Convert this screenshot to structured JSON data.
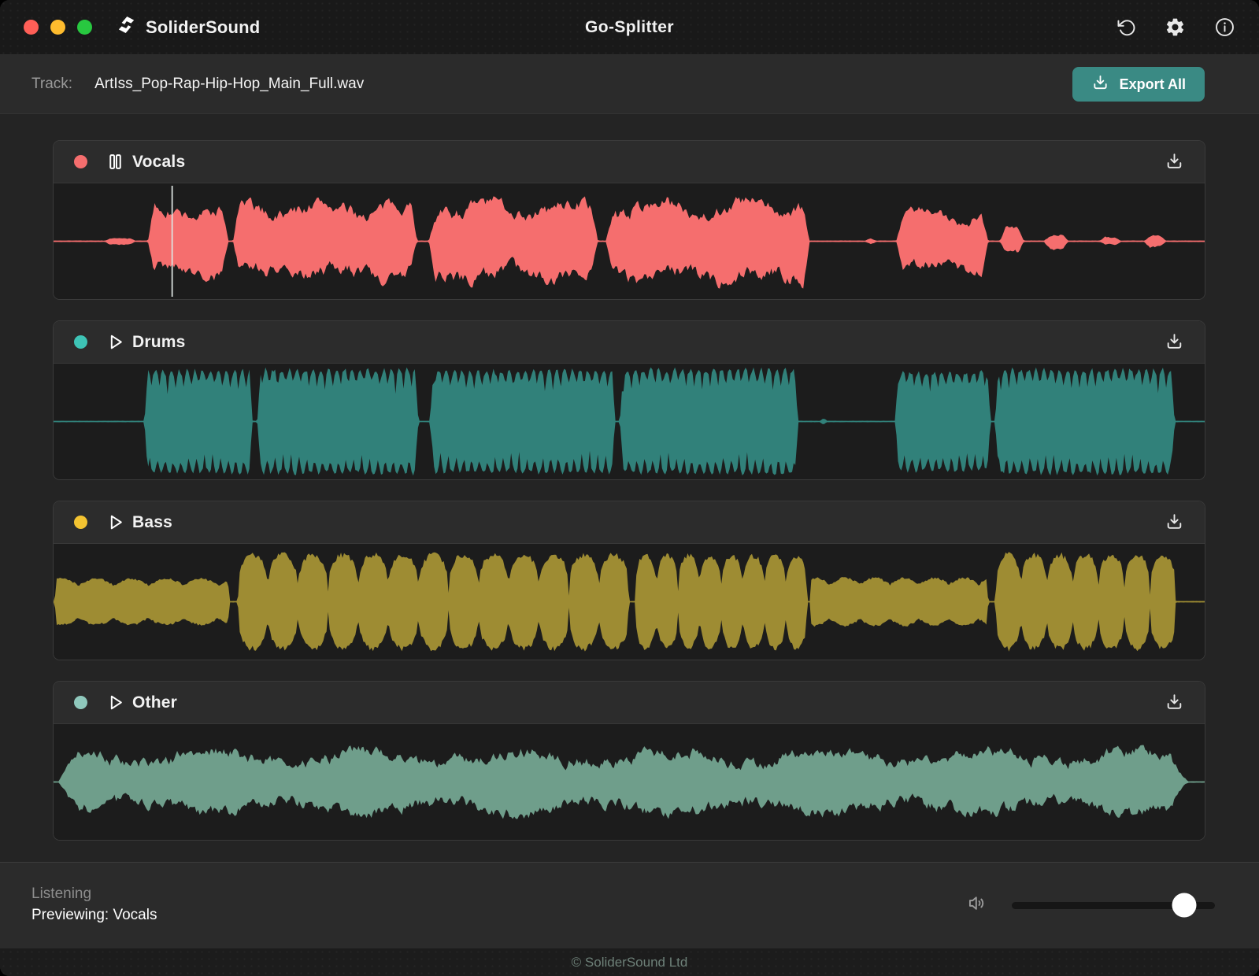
{
  "titlebar": {
    "brand": "SoliderSound",
    "title": "Go-Splitter",
    "window_controls": [
      "close",
      "minimize",
      "zoom"
    ],
    "window_control_colors": {
      "close": "#ff5f57",
      "minimize": "#febc2e",
      "zoom": "#28c840"
    },
    "icons": [
      "brand-logo-icon",
      "reset-icon",
      "settings-icon",
      "info-icon"
    ]
  },
  "trackbar": {
    "label": "Track:",
    "filename": "ArtIss_Pop-Rap-Hip-Hop_Main_Full.wav",
    "export_label": "Export All",
    "export_icon": "download-icon"
  },
  "colors": {
    "accent": "#3a8a84",
    "page_background": "#242424",
    "panel_background": "#2b2b2b",
    "waveform_background": "#1c1c1c"
  },
  "stems": [
    {
      "name": "Vocals",
      "state": "playing",
      "transport_icon": "pause-icon",
      "color": "#f56e6e",
      "dot_color": "#f56e6e",
      "style": "smooth",
      "seed": 7,
      "playhead": 0.103,
      "segments": [
        {
          "s": 0.043,
          "e": 0.072,
          "a": 0.07
        },
        {
          "s": 0.082,
          "e": 0.152,
          "a": 0.74
        },
        {
          "s": 0.156,
          "e": 0.316,
          "a": 0.8
        },
        {
          "s": 0.326,
          "e": 0.473,
          "a": 0.82
        },
        {
          "s": 0.48,
          "e": 0.657,
          "a": 0.84
        },
        {
          "s": 0.704,
          "e": 0.716,
          "a": 0.08
        },
        {
          "s": 0.732,
          "e": 0.812,
          "a": 0.64
        },
        {
          "s": 0.822,
          "e": 0.843,
          "a": 0.32
        },
        {
          "s": 0.86,
          "e": 0.882,
          "a": 0.17
        },
        {
          "s": 0.908,
          "e": 0.928,
          "a": 0.11
        },
        {
          "s": 0.947,
          "e": 0.967,
          "a": 0.13
        }
      ]
    },
    {
      "name": "Drums",
      "state": "stopped",
      "transport_icon": "play-icon",
      "color": "#31817a",
      "dot_color": "#3ec4b6",
      "style": "spiky",
      "seed": 11,
      "playhead": null,
      "segments": [
        {
          "s": 0.079,
          "e": 0.173,
          "a": 0.96
        },
        {
          "s": 0.177,
          "e": 0.317,
          "a": 0.98
        },
        {
          "s": 0.327,
          "e": 0.488,
          "a": 0.96
        },
        {
          "s": 0.492,
          "e": 0.647,
          "a": 0.98
        },
        {
          "s": 0.665,
          "e": 0.673,
          "a": 0.05
        },
        {
          "s": 0.731,
          "e": 0.814,
          "a": 0.93
        },
        {
          "s": 0.818,
          "e": 0.974,
          "a": 0.98
        }
      ]
    },
    {
      "name": "Bass",
      "state": "stopped",
      "transport_icon": "play-icon",
      "color": "#9e8c33",
      "dot_color": "#f3c331",
      "style": "lobes",
      "seed": 23,
      "playhead": null,
      "segments": [
        {
          "s": 0.001,
          "e": 0.153,
          "a": 0.44,
          "f": 2.5
        },
        {
          "s": 0.16,
          "e": 0.5,
          "a": 0.96,
          "f": 13
        },
        {
          "s": 0.505,
          "e": 0.655,
          "a": 0.94,
          "f": 8
        },
        {
          "s": 0.657,
          "e": 0.812,
          "a": 0.46,
          "f": 3
        },
        {
          "s": 0.818,
          "e": 0.975,
          "a": 0.96,
          "f": 7
        }
      ]
    },
    {
      "name": "Other",
      "state": "stopped",
      "transport_icon": "play-icon",
      "color": "#6f9e8b",
      "dot_color": "#8fc8bc",
      "style": "noise",
      "seed": 5,
      "playhead": null,
      "segments": [
        {
          "s": 0.004,
          "e": 0.986,
          "a": 0.62
        }
      ]
    }
  ],
  "statusbar": {
    "line1": "Listening",
    "line2": "Previewing: Vocals",
    "volume": 0.85,
    "icons": [
      "speaker-icon"
    ]
  },
  "footer": {
    "copyright": "© SoliderSound Ltd"
  }
}
